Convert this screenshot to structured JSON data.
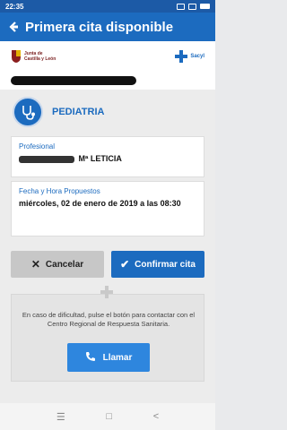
{
  "status": {
    "time": "22:35"
  },
  "app": {
    "title": "Primera cita disponible"
  },
  "logos": {
    "left_line1": "Junta de",
    "left_line2": "Castilla y León",
    "right": "Sacyl"
  },
  "specialty": {
    "name": "PEDIATRIA"
  },
  "professional": {
    "label": "Profesional",
    "value": "Mª LETICIA"
  },
  "datetime": {
    "label": "Fecha y Hora Propuestos",
    "value": "miércoles, 02 de enero de 2019 a las 08:30"
  },
  "actions": {
    "cancel": "Cancelar",
    "confirm": "Confirmar cita"
  },
  "help": {
    "text": "En caso de dificultad, pulse el botón para contactar con el Centro Regional de Respuesta Sanitaria.",
    "call": "Llamar"
  },
  "nav": {
    "menu": "☰",
    "home": "□",
    "back": "<"
  },
  "colors": {
    "primary": "#1c6bbf",
    "statusbar": "#1c5aa6",
    "call": "#2e86de"
  }
}
